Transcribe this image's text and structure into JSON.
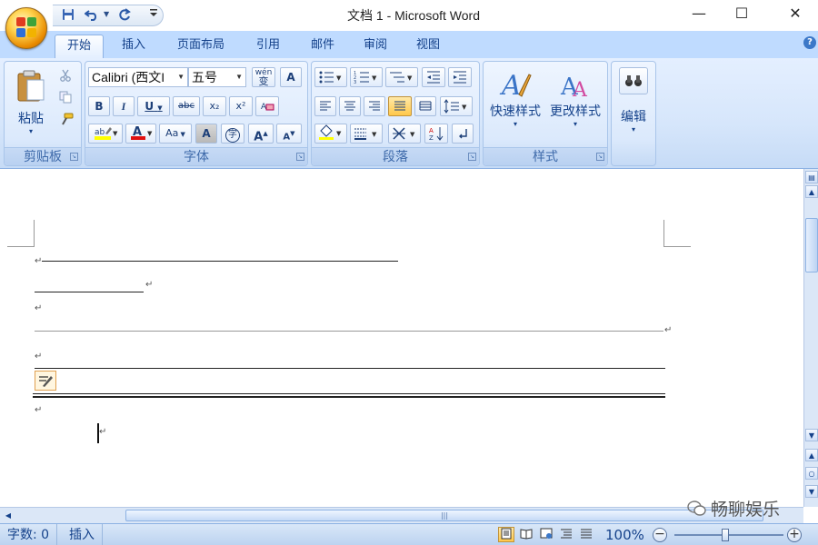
{
  "window": {
    "title": "文档 1 - Microsoft Word",
    "minimize": "—",
    "maximize": "☐",
    "close": "✕"
  },
  "qat": {
    "save": "💾",
    "undo": "↶",
    "redo": "↻",
    "more": "▾"
  },
  "tabs": [
    {
      "label": "开始",
      "active": true
    },
    {
      "label": "插入"
    },
    {
      "label": "页面布局"
    },
    {
      "label": "引用"
    },
    {
      "label": "邮件"
    },
    {
      "label": "审阅"
    },
    {
      "label": "视图"
    }
  ],
  "help": "?",
  "ribbon": {
    "clipboard": {
      "label": "剪贴板",
      "paste": "粘贴"
    },
    "font": {
      "label": "字体",
      "font_name": "Calibri (西文I",
      "font_size": "五号",
      "bold": "B",
      "italic": "I",
      "underline": "U",
      "strike": "abc",
      "subscript": "x₂",
      "superscript": "x²",
      "grow": "A",
      "shrink": "A",
      "change_case": "Aa",
      "char_shading": "A",
      "enclose": "字",
      "pinyin": "wén",
      "border": "A"
    },
    "paragraph": {
      "label": "段落"
    },
    "styles": {
      "label": "样式",
      "quick_styles": "快速样式",
      "change_styles": "更改样式"
    },
    "editing": {
      "label": "编辑"
    }
  },
  "document": {
    "return_mark": "↵"
  },
  "status": {
    "word_count": "字数: 0",
    "insert_mode": "插入",
    "zoom": "100%",
    "zoom_minus": "−",
    "zoom_plus": "+"
  },
  "watermark": "畅聊娱乐",
  "colors": {
    "accent": "#15428b",
    "ribbon_bg": "#dbe9fc",
    "highlight": "#ffc84a",
    "font_color_bar": "#e01010",
    "highlight_bar": "#ffff00"
  }
}
